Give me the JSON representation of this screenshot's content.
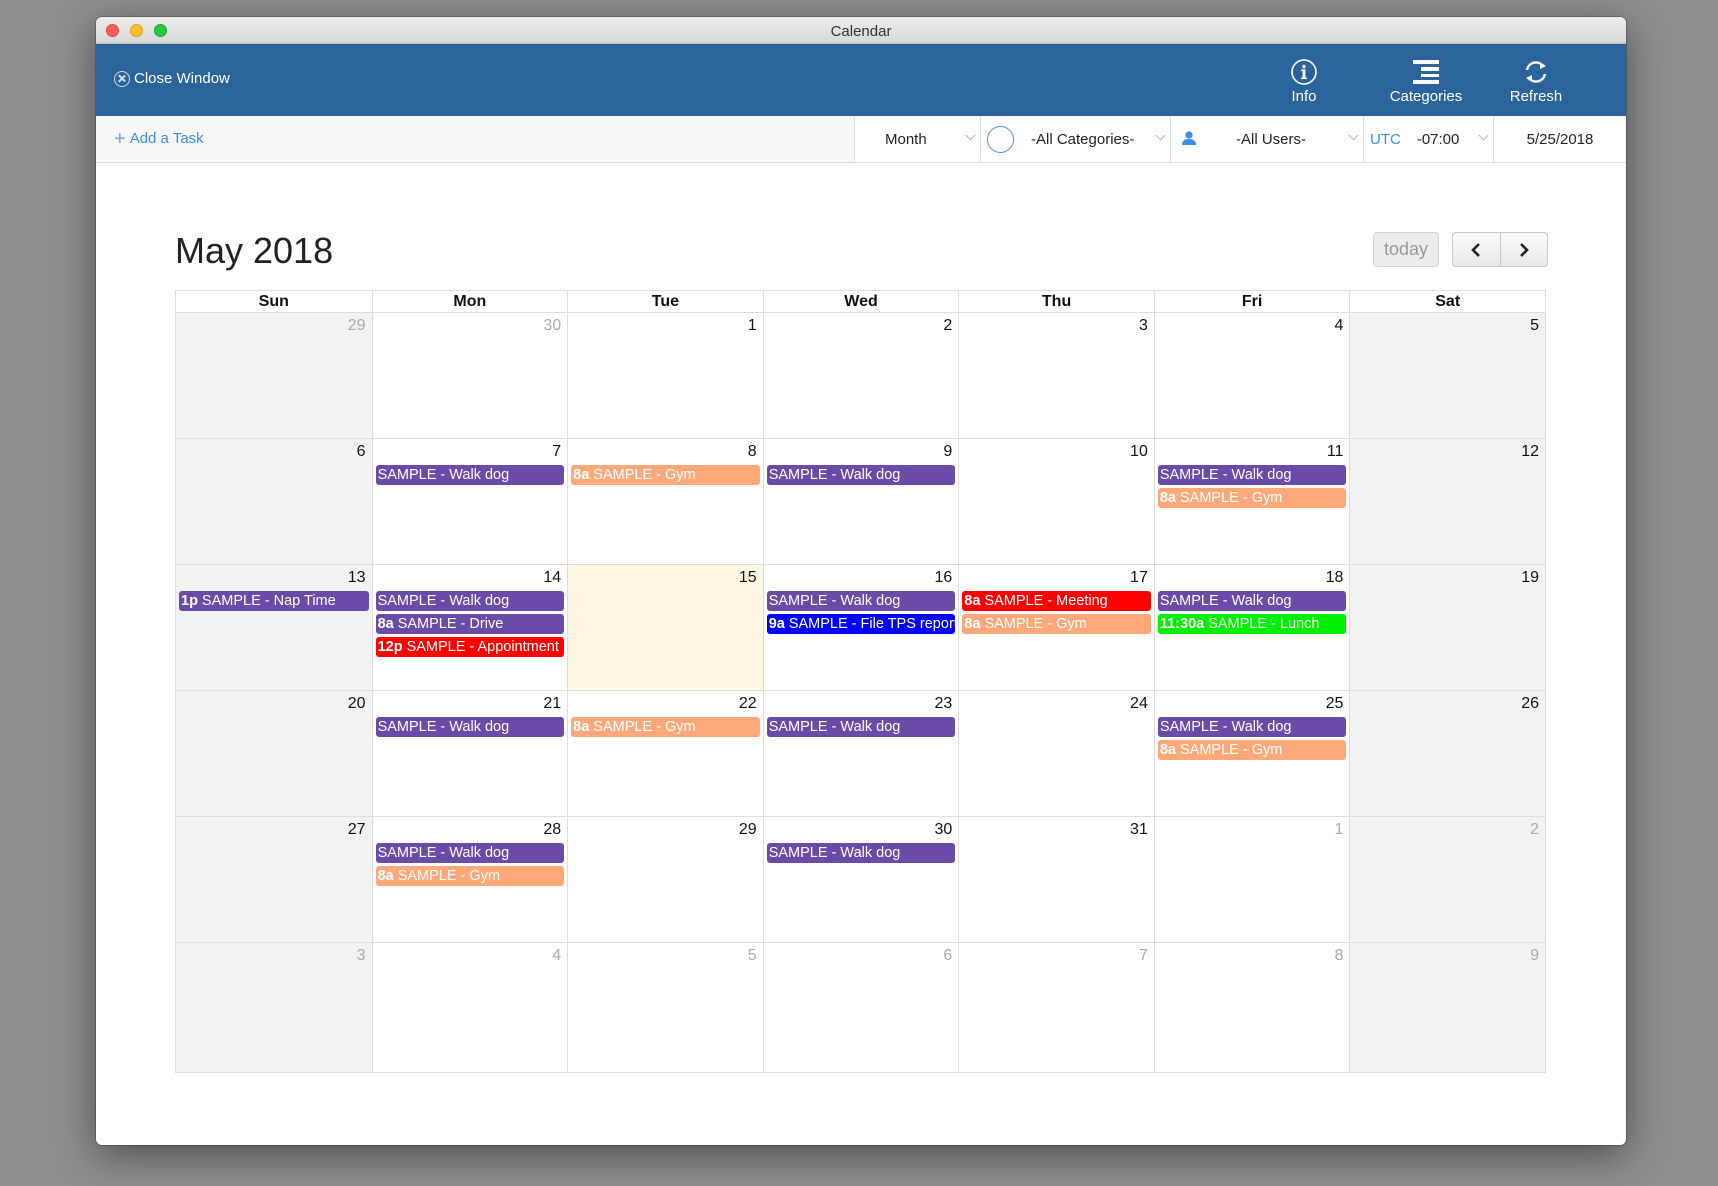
{
  "window": {
    "title": "Calendar"
  },
  "header": {
    "close_label": "Close Window",
    "buttons": [
      {
        "label": "Info",
        "icon": "info-icon"
      },
      {
        "label": "Categories",
        "icon": "categories-icon"
      },
      {
        "label": "Refresh",
        "icon": "refresh-icon"
      }
    ]
  },
  "toolbar": {
    "add_task_label": "Add a Task",
    "view_select": "Month",
    "category_select": "-All Categories-",
    "user_select": "-All Users-",
    "timezone_label": "UTC",
    "timezone_offset": "-07:00",
    "date": "5/25/2018"
  },
  "calendar": {
    "title": "May 2018",
    "today_label": "today",
    "prev_label": "‹",
    "next_label": "›",
    "colors": {
      "purple": "#6a4ca8",
      "salmon": "#ffa97a",
      "red": "#ff0000",
      "blue": "#0000ff",
      "green": "#00ee00"
    },
    "days_of_week": [
      "Sun",
      "Mon",
      "Tue",
      "Wed",
      "Thu",
      "Fri",
      "Sat"
    ],
    "weeks": [
      [
        {
          "day": "29",
          "other": true,
          "events": []
        },
        {
          "day": "30",
          "other": true,
          "events": []
        },
        {
          "day": "1",
          "events": []
        },
        {
          "day": "2",
          "events": []
        },
        {
          "day": "3",
          "events": []
        },
        {
          "day": "4",
          "events": []
        },
        {
          "day": "5",
          "events": []
        }
      ],
      [
        {
          "day": "6",
          "events": []
        },
        {
          "day": "7",
          "events": [
            {
              "time": "",
              "title": "SAMPLE - Walk dog",
              "color": "purple"
            }
          ]
        },
        {
          "day": "8",
          "events": [
            {
              "time": "8a",
              "title": "SAMPLE - Gym",
              "color": "salmon"
            }
          ]
        },
        {
          "day": "9",
          "events": [
            {
              "time": "",
              "title": "SAMPLE - Walk dog",
              "color": "purple"
            }
          ]
        },
        {
          "day": "10",
          "events": []
        },
        {
          "day": "11",
          "events": [
            {
              "time": "",
              "title": "SAMPLE - Walk dog",
              "color": "purple"
            },
            {
              "time": "8a",
              "title": "SAMPLE - Gym",
              "color": "salmon"
            }
          ]
        },
        {
          "day": "12",
          "events": []
        }
      ],
      [
        {
          "day": "13",
          "events": [
            {
              "time": "1p",
              "title": "SAMPLE - Nap Time",
              "color": "purple"
            }
          ]
        },
        {
          "day": "14",
          "events": [
            {
              "time": "",
              "title": "SAMPLE - Walk dog",
              "color": "purple"
            },
            {
              "time": "8a",
              "title": "SAMPLE - Drive",
              "color": "purple"
            },
            {
              "time": "12p",
              "title": "SAMPLE - Appointment",
              "color": "red"
            }
          ]
        },
        {
          "day": "15",
          "today": true,
          "events": []
        },
        {
          "day": "16",
          "events": [
            {
              "time": "",
              "title": "SAMPLE - Walk dog",
              "color": "purple"
            },
            {
              "time": "9a",
              "title": "SAMPLE - File TPS report",
              "color": "blue"
            }
          ]
        },
        {
          "day": "17",
          "events": [
            {
              "time": "8a",
              "title": "SAMPLE - Meeting",
              "color": "red"
            },
            {
              "time": "8a",
              "title": "SAMPLE - Gym",
              "color": "salmon"
            }
          ]
        },
        {
          "day": "18",
          "events": [
            {
              "time": "",
              "title": "SAMPLE - Walk dog",
              "color": "purple"
            },
            {
              "time": "11:30a",
              "title": "SAMPLE - Lunch",
              "color": "green"
            }
          ]
        },
        {
          "day": "19",
          "events": []
        }
      ],
      [
        {
          "day": "20",
          "events": []
        },
        {
          "day": "21",
          "events": [
            {
              "time": "",
              "title": "SAMPLE - Walk dog",
              "color": "purple"
            }
          ]
        },
        {
          "day": "22",
          "events": [
            {
              "time": "8a",
              "title": "SAMPLE - Gym",
              "color": "salmon"
            }
          ]
        },
        {
          "day": "23",
          "events": [
            {
              "time": "",
              "title": "SAMPLE - Walk dog",
              "color": "purple"
            }
          ]
        },
        {
          "day": "24",
          "events": []
        },
        {
          "day": "25",
          "events": [
            {
              "time": "",
              "title": "SAMPLE - Walk dog",
              "color": "purple"
            },
            {
              "time": "8a",
              "title": "SAMPLE - Gym",
              "color": "salmon"
            }
          ]
        },
        {
          "day": "26",
          "events": []
        }
      ],
      [
        {
          "day": "27",
          "events": []
        },
        {
          "day": "28",
          "events": [
            {
              "time": "",
              "title": "SAMPLE - Walk dog",
              "color": "purple"
            },
            {
              "time": "8a",
              "title": "SAMPLE - Gym",
              "color": "salmon"
            }
          ]
        },
        {
          "day": "29",
          "events": []
        },
        {
          "day": "30",
          "events": [
            {
              "time": "",
              "title": "SAMPLE - Walk dog",
              "color": "purple"
            }
          ]
        },
        {
          "day": "31",
          "events": []
        },
        {
          "day": "1",
          "other": true,
          "events": []
        },
        {
          "day": "2",
          "other": true,
          "events": []
        }
      ],
      [
        {
          "day": "3",
          "other": true,
          "events": []
        },
        {
          "day": "4",
          "other": true,
          "events": []
        },
        {
          "day": "5",
          "other": true,
          "events": []
        },
        {
          "day": "6",
          "other": true,
          "events": []
        },
        {
          "day": "7",
          "other": true,
          "events": []
        },
        {
          "day": "8",
          "other": true,
          "events": []
        },
        {
          "day": "9",
          "other": true,
          "events": []
        }
      ]
    ]
  }
}
